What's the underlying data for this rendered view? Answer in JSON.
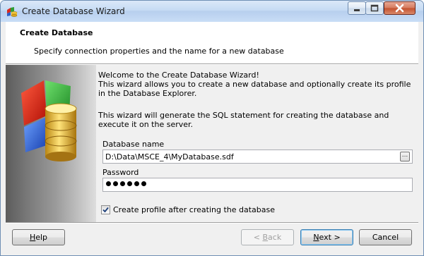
{
  "window": {
    "title": "Create Database Wizard"
  },
  "header": {
    "title": "Create Database",
    "subtitle": "Specify connection properties and the name for a new database"
  },
  "content": {
    "welcome_line": "Welcome to the Create Database Wizard!",
    "intro_line": "This wizard allows you to create a new database and optionally create its profile in the Database Explorer.",
    "sql_line": "This wizard will generate the SQL statement for creating the database and execute it on the server."
  },
  "form": {
    "database_name_label": "Database name",
    "database_name_value": "D:\\Data\\MSCE_4\\MyDatabase.sdf",
    "browse_label": "...",
    "password_label": "Password",
    "password_masked_length": 6,
    "create_profile_label": "Create profile after creating the database",
    "create_profile_checked": true
  },
  "buttons": {
    "help_prefix": "H",
    "help_rest": "elp",
    "back_prefix": "< ",
    "back_hot": "B",
    "back_rest": "ack",
    "next_hot": "N",
    "next_rest": "ext >",
    "cancel": "Cancel"
  },
  "colors": {
    "accent_blue": "#3c7fb1",
    "titlebar": "#c6dbf4",
    "close_red": "#c34f2e"
  }
}
